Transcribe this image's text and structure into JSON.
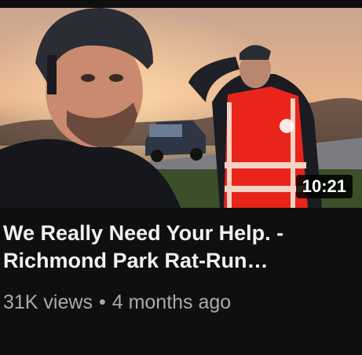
{
  "video": {
    "thumbnail_icon": "video-thumbnail",
    "duration": "10:21",
    "title_line1": "We Really Need Your Help. -",
    "title_line2": "Richmond Park Rat-Run…",
    "views": "31K views",
    "separator": "•",
    "age": "4 months ago"
  },
  "colors": {
    "background": "#0f0f0f",
    "title": "#f1f1f1",
    "meta": "#aaaaaa",
    "vest": "#e8241b"
  }
}
